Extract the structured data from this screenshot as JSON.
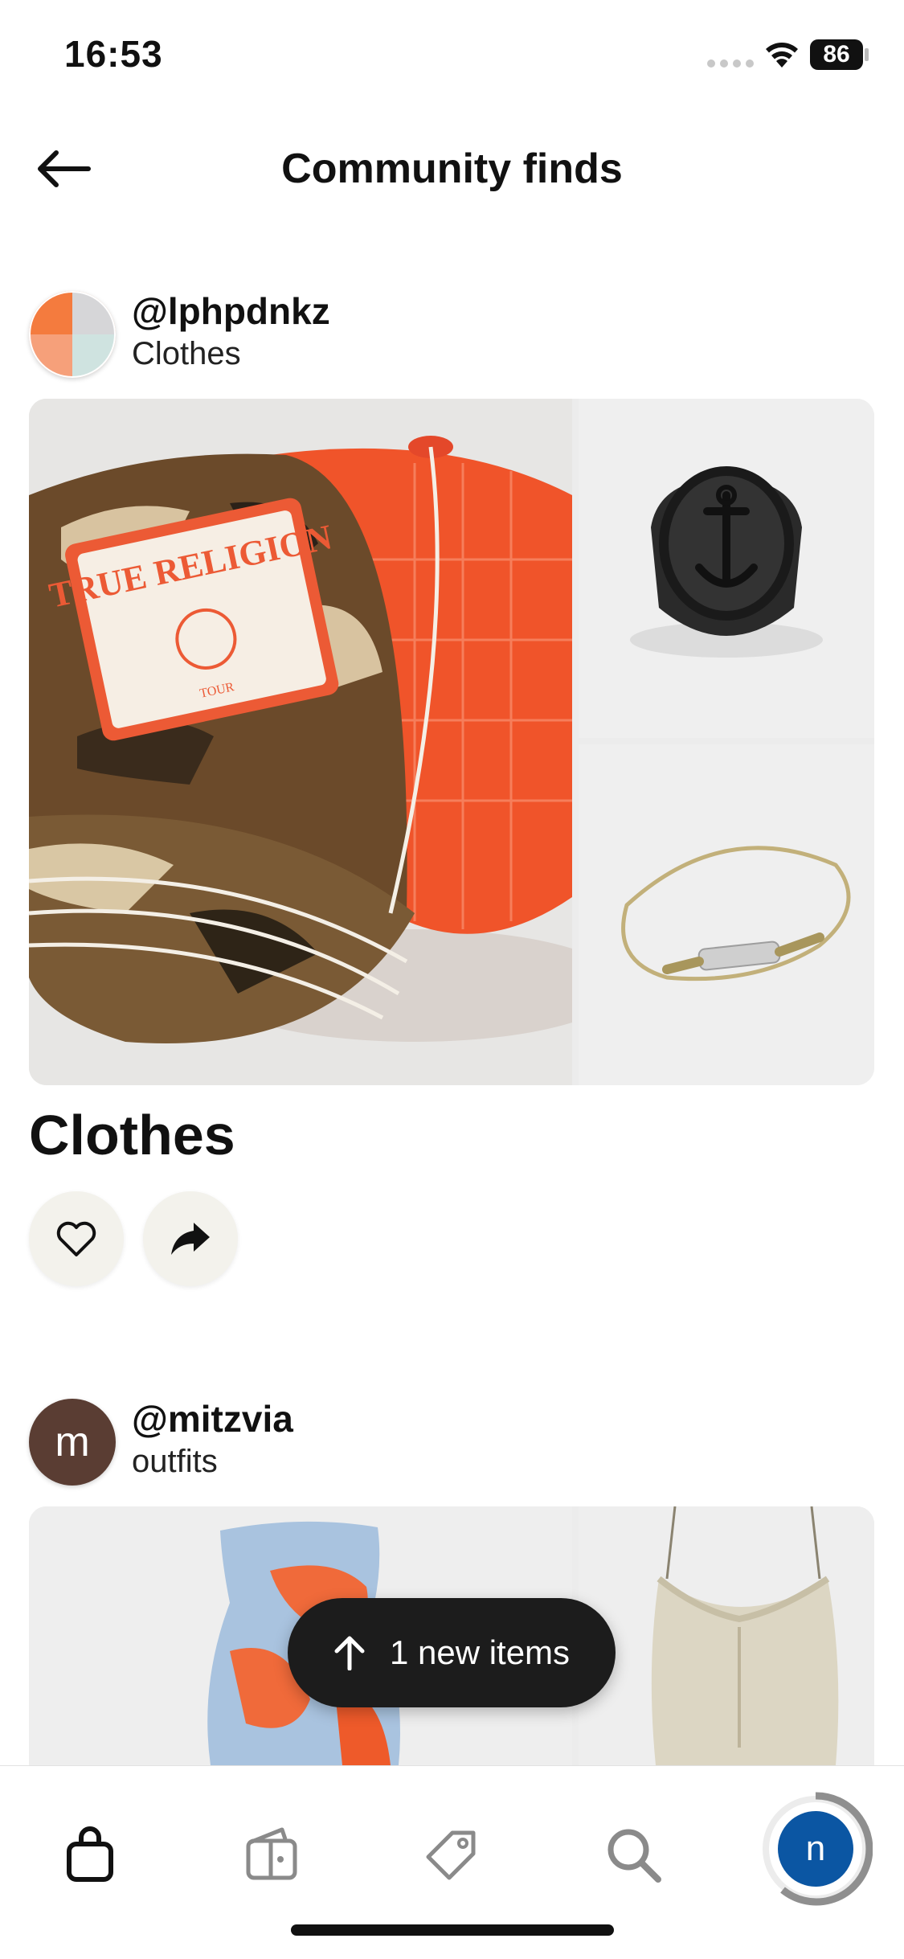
{
  "status_bar": {
    "time": "16:53",
    "battery": "86"
  },
  "header": {
    "title": "Community finds"
  },
  "posts": [
    {
      "username": "@lphpdnkz",
      "board": "Clothes",
      "title": "Clothes",
      "images": [
        "trucker-cap",
        "anchor-ring",
        "cord-bracelet"
      ]
    },
    {
      "username": "@mitzvia",
      "avatar_letter": "m",
      "board": "outfits",
      "images": [
        "tie-dye-dress",
        "ruffle-cami-top"
      ]
    }
  ],
  "toast": {
    "label": "1 new items"
  },
  "tabbar": {
    "items": [
      "shop-icon",
      "boards-icon",
      "tag-icon",
      "search-icon",
      "profile"
    ],
    "profile_letter": "n"
  },
  "colors": {
    "accent_orange": "#f0542a",
    "profile_blue": "#0b56a3",
    "avatar_brown": "#5a3d33"
  }
}
